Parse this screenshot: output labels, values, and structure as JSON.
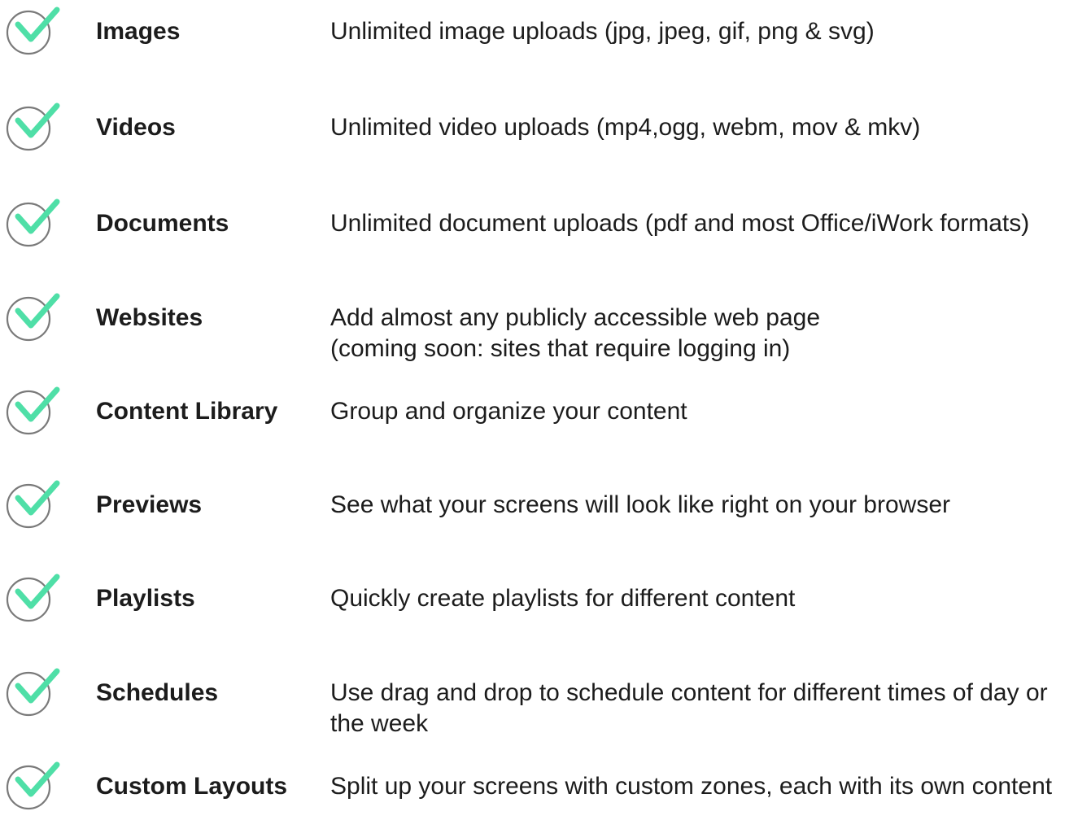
{
  "theme": {
    "check_color": "#4fdfa7",
    "circle_color": "#7a7a7a",
    "text_color": "#1c1c1c"
  },
  "features": [
    {
      "icon": "check-circle-icon",
      "name": "Images",
      "description": "Unlimited image uploads (jpg, jpeg, gif, png & svg)"
    },
    {
      "icon": "check-circle-icon",
      "name": "Videos",
      "description": "Unlimited video uploads (mp4,ogg, webm, mov & mkv)"
    },
    {
      "icon": "check-circle-icon",
      "name": "Documents",
      "description": "Unlimited document uploads (pdf and most Office/iWork formats)"
    },
    {
      "icon": "check-circle-icon",
      "name": "Websites",
      "description": "Add almost any publicly accessible web page\n (coming soon: sites that require logging in)"
    },
    {
      "icon": "check-circle-icon",
      "name": "Content Library",
      "description": "Group and organize your content"
    },
    {
      "icon": "check-circle-icon",
      "name": "Previews",
      "description": "See what your screens will look like right on your browser"
    },
    {
      "icon": "check-circle-icon",
      "name": "Playlists",
      "description": "Quickly create playlists for different content"
    },
    {
      "icon": "check-circle-icon",
      "name": "Schedules",
      "description": "Use drag and drop to schedule content for different times of day or\nthe week"
    },
    {
      "icon": "check-circle-icon",
      "name": "Custom Layouts",
      "description": "Split up your screens with custom zones, each with its own content"
    }
  ]
}
